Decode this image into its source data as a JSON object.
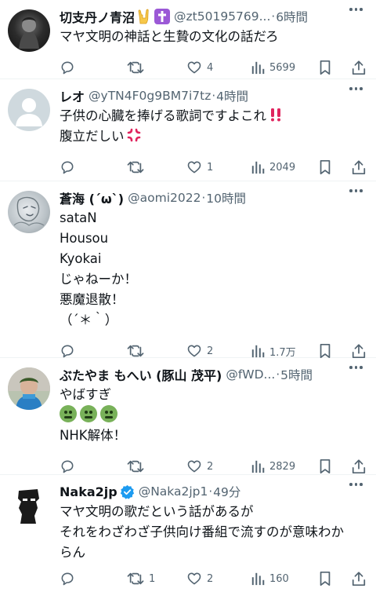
{
  "replies": [
    {
      "name": "切支丹ノ青沼",
      "handle": "@zt50195769...",
      "time": "6時間",
      "lines": [
        "マヤ文明の神話と生贄の文化の話だろ"
      ],
      "reply_count": "",
      "retweets": "",
      "likes": "4",
      "views": "5699",
      "name_emojis": [
        "sign-of-horns-emoji",
        "latin-cross-emoji"
      ]
    },
    {
      "name": "レオ",
      "handle": "@yTN4F0g9BM7i7tz",
      "time": "4時間",
      "lines": [
        "子供の心臓を捧げる歌詞ですよこれ",
        "腹立だしい"
      ],
      "reply_count": "",
      "retweets": "",
      "likes": "1",
      "views": "2049",
      "line_emojis": [
        "double-exclamation-emoji",
        "anger-symbol-emoji"
      ]
    },
    {
      "name": "蒼海 (´ω`)",
      "handle": "@aomi2022",
      "time": "10時間",
      "lines": [
        "sataN",
        "Housou",
        "Kyokai",
        "じゃねーか！",
        "悪魔退散！",
        "（´＊｀）"
      ],
      "reply_count": "",
      "retweets": "",
      "likes": "2",
      "views": "1.7万"
    },
    {
      "name": "ぶたやま もへい (豚山 茂平)",
      "handle": "@fWD...",
      "time": "5時間",
      "lines": [
        "やばすぎ",
        "",
        "NHK解体！"
      ],
      "reply_count": "",
      "retweets": "",
      "likes": "2",
      "views": "2829",
      "line_emojis": [
        "nauseated-face-emoji"
      ]
    },
    {
      "name": "Naka2jp",
      "handle": "@Naka2jp1",
      "time": "49分",
      "lines": [
        "マヤ文明の歌だという話があるが",
        "それをわざわざ子供向け番組で流すのが意味わか",
        "らん"
      ],
      "reply_count": "",
      "retweets": "1",
      "likes": "2",
      "views": "160",
      "verified": true
    }
  ],
  "separator": "·",
  "colors": {
    "text": "#0f1419",
    "secondary": "#536471",
    "border": "#eff3f4",
    "verified": "#1d9bf0"
  }
}
